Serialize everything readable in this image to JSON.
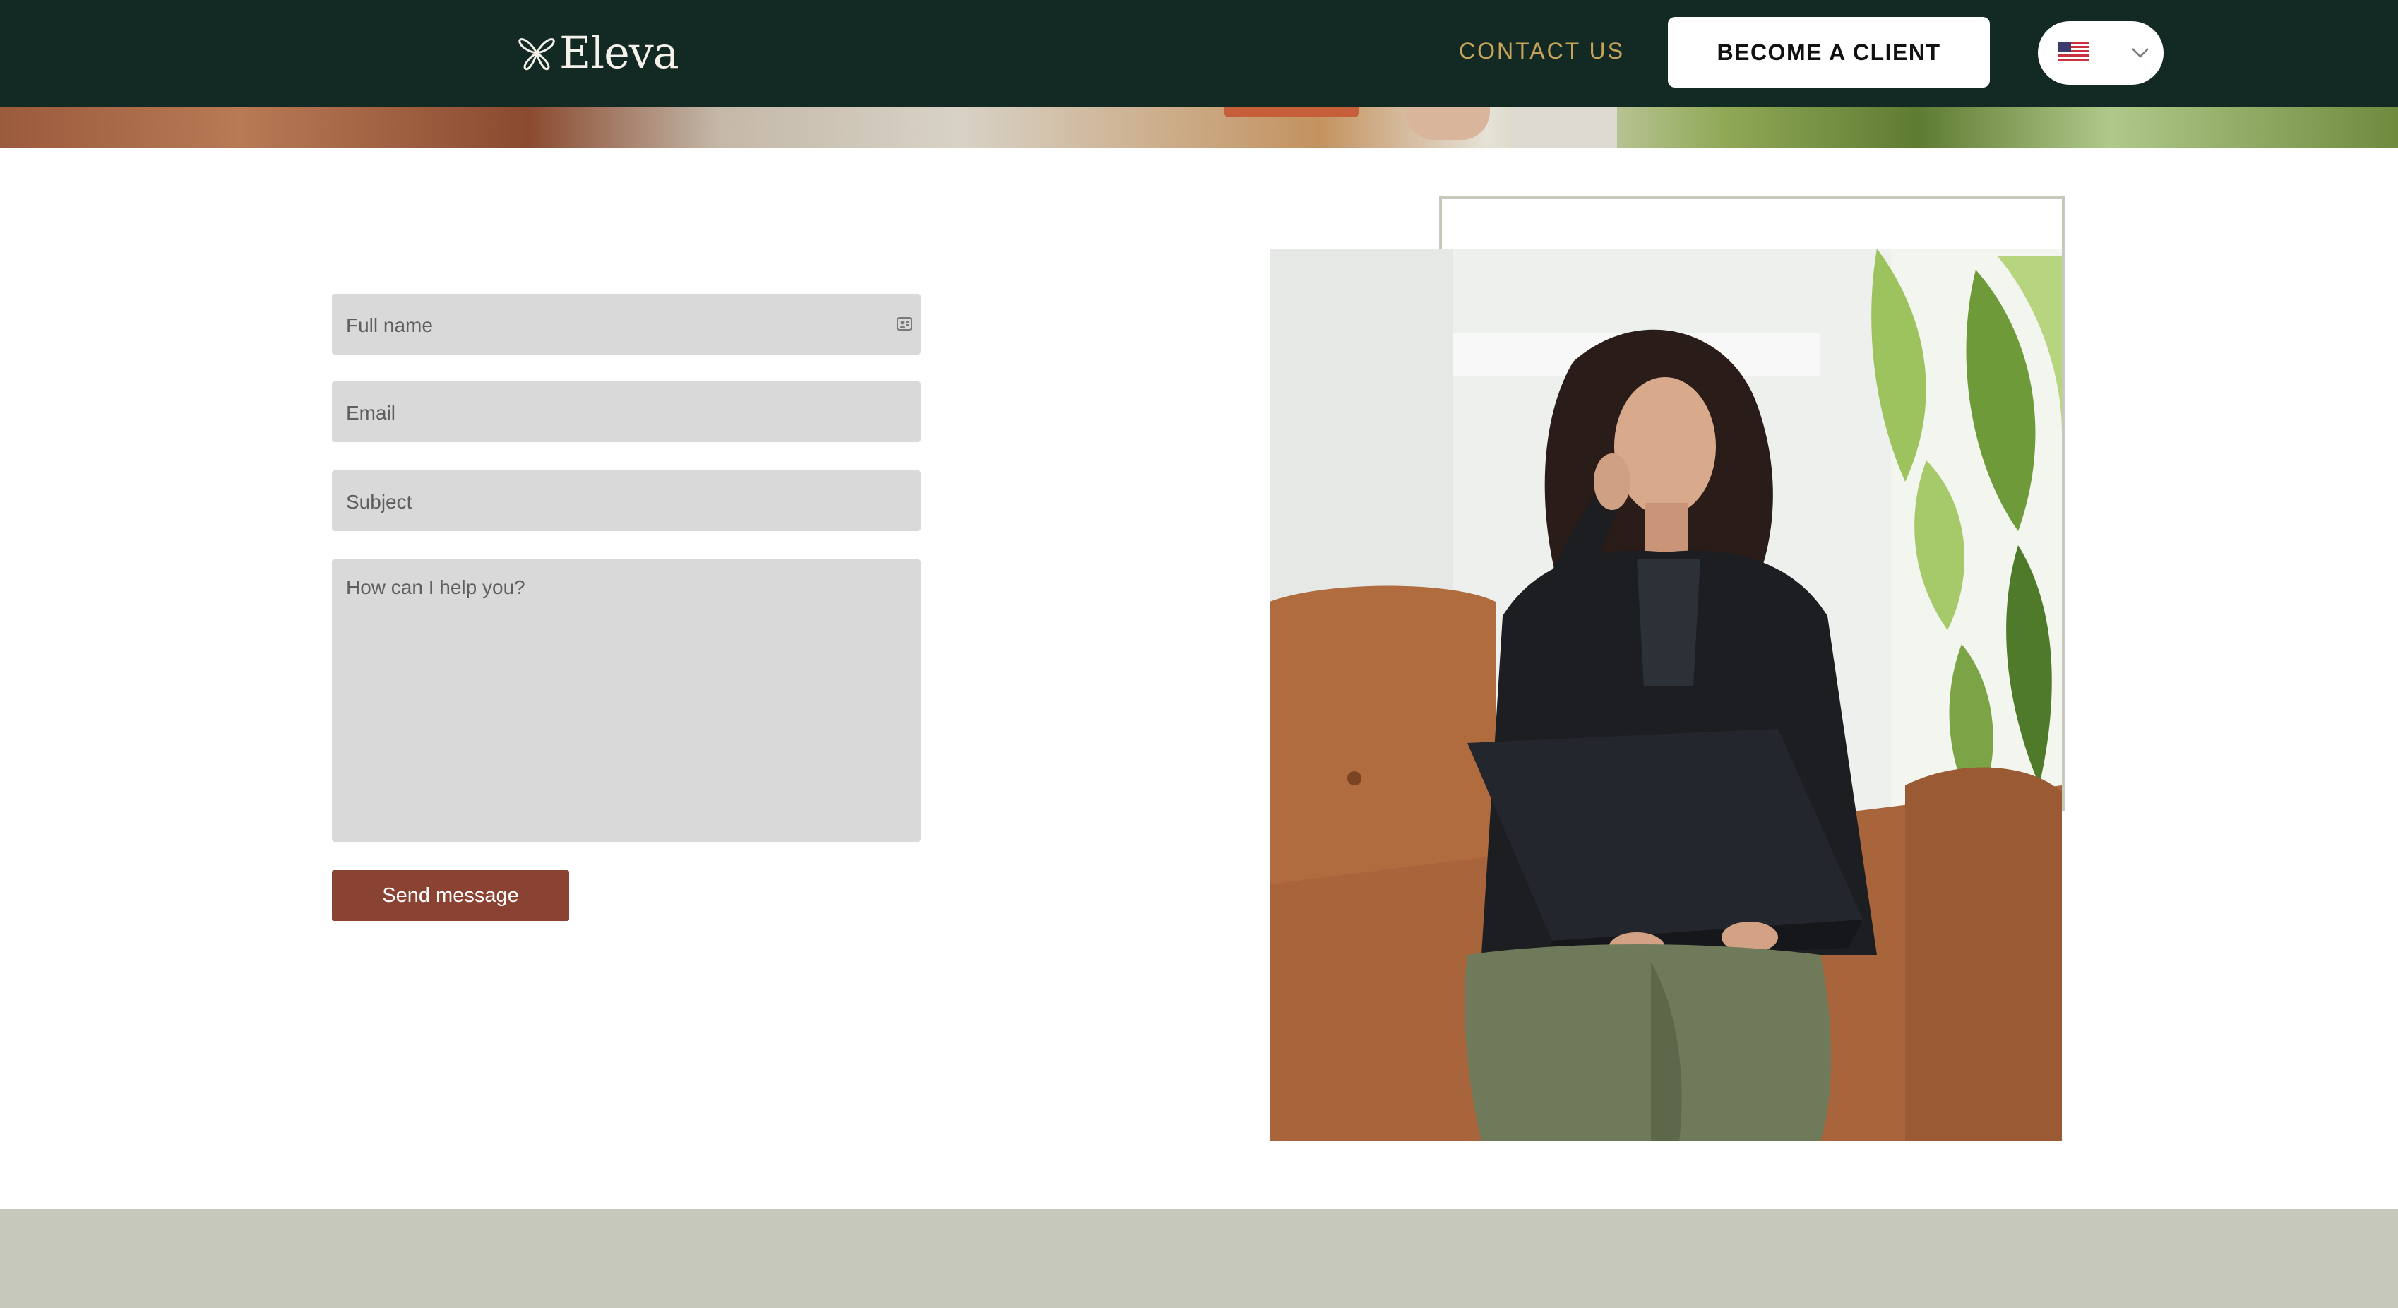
{
  "header": {
    "logo_text": "Eleva",
    "nav_contact": "CONTACT US",
    "cta_label": "BECOME A CLIENT",
    "language": {
      "flag": "us-flag-icon",
      "dropdown_icon": "chevron-down-icon"
    }
  },
  "form": {
    "full_name_placeholder": "Full name",
    "email_placeholder": "Email",
    "subject_placeholder": "Subject",
    "message_placeholder": "How can I help you?",
    "submit_label": "Send message"
  },
  "colors": {
    "header_bg": "#132a24",
    "accent_gold": "#c9a55b",
    "button_brown": "#8a4332",
    "field_bg": "#d9d9d9",
    "footer_band": "#c7c8bc"
  }
}
